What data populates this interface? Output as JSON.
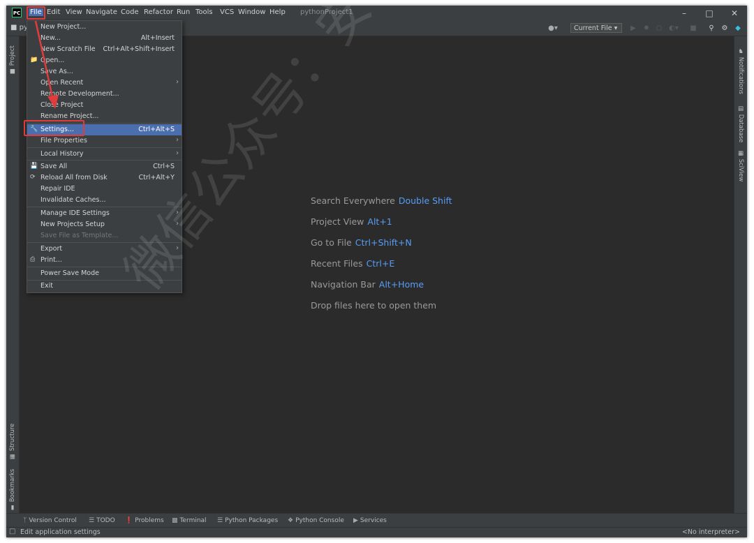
{
  "app": {
    "icon_text": "PC",
    "window_title": "pythonProject1"
  },
  "menubar": [
    "File",
    "Edit",
    "View",
    "Navigate",
    "Code",
    "Refactor",
    "Run",
    "Tools",
    "VCS",
    "Window",
    "Help"
  ],
  "toolbar": {
    "project_crumb": "py",
    "run_config": "Current File"
  },
  "left_panel": {
    "project": "Project",
    "structure": "Structure",
    "bookmarks": "Bookmarks"
  },
  "right_panel": {
    "notifications": "Notifications",
    "database": "Database",
    "sciview": "SciView"
  },
  "file_menu": {
    "items": [
      {
        "label": "New Project...",
        "shortcut": ""
      },
      {
        "label": "New...",
        "shortcut": "Alt+Insert"
      },
      {
        "label": "New Scratch File",
        "shortcut": "Ctrl+Alt+Shift+Insert"
      },
      {
        "label": "Open...",
        "shortcut": ""
      },
      {
        "label": "Save As...",
        "shortcut": ""
      },
      {
        "label": "Open Recent",
        "shortcut": ""
      },
      {
        "label": "Remote Development...",
        "shortcut": ""
      },
      {
        "label": "Close Project",
        "shortcut": ""
      },
      {
        "label": "Rename Project...",
        "shortcut": ""
      },
      {
        "label": "Settings...",
        "shortcut": "Ctrl+Alt+S"
      },
      {
        "label": "File Properties",
        "shortcut": ""
      },
      {
        "label": "Local History",
        "shortcut": ""
      },
      {
        "label": "Save All",
        "shortcut": "Ctrl+S"
      },
      {
        "label": "Reload All from Disk",
        "shortcut": "Ctrl+Alt+Y"
      },
      {
        "label": "Repair IDE",
        "shortcut": ""
      },
      {
        "label": "Invalidate Caches...",
        "shortcut": ""
      },
      {
        "label": "Manage IDE Settings",
        "shortcut": ""
      },
      {
        "label": "New Projects Setup",
        "shortcut": ""
      },
      {
        "label": "Save File as Template...",
        "shortcut": ""
      },
      {
        "label": "Export",
        "shortcut": ""
      },
      {
        "label": "Print...",
        "shortcut": ""
      },
      {
        "label": "Power Save Mode",
        "shortcut": ""
      },
      {
        "label": "Exit",
        "shortcut": ""
      }
    ]
  },
  "welcome": [
    {
      "label": "Search Everywhere",
      "key": "Double Shift"
    },
    {
      "label": "Project View",
      "key": "Alt+1"
    },
    {
      "label": "Go to File",
      "key": "Ctrl+Shift+N"
    },
    {
      "label": "Recent Files",
      "key": "Ctrl+E"
    },
    {
      "label": "Navigation Bar",
      "key": "Alt+Home"
    },
    {
      "label": "Drop files here to open them",
      "key": ""
    }
  ],
  "bottom_tools": [
    "Version Control",
    "TODO",
    "Problems",
    "Terminal",
    "Python Packages",
    "Python Console",
    "Services"
  ],
  "status": {
    "left": "Edit application settings",
    "right": "<No interpreter>"
  },
  "watermark": "微信公众号：安装软件指南",
  "colors": {
    "accent": "#4b6eaf",
    "key_text": "#589df6",
    "annotation": "#e03c3c"
  }
}
